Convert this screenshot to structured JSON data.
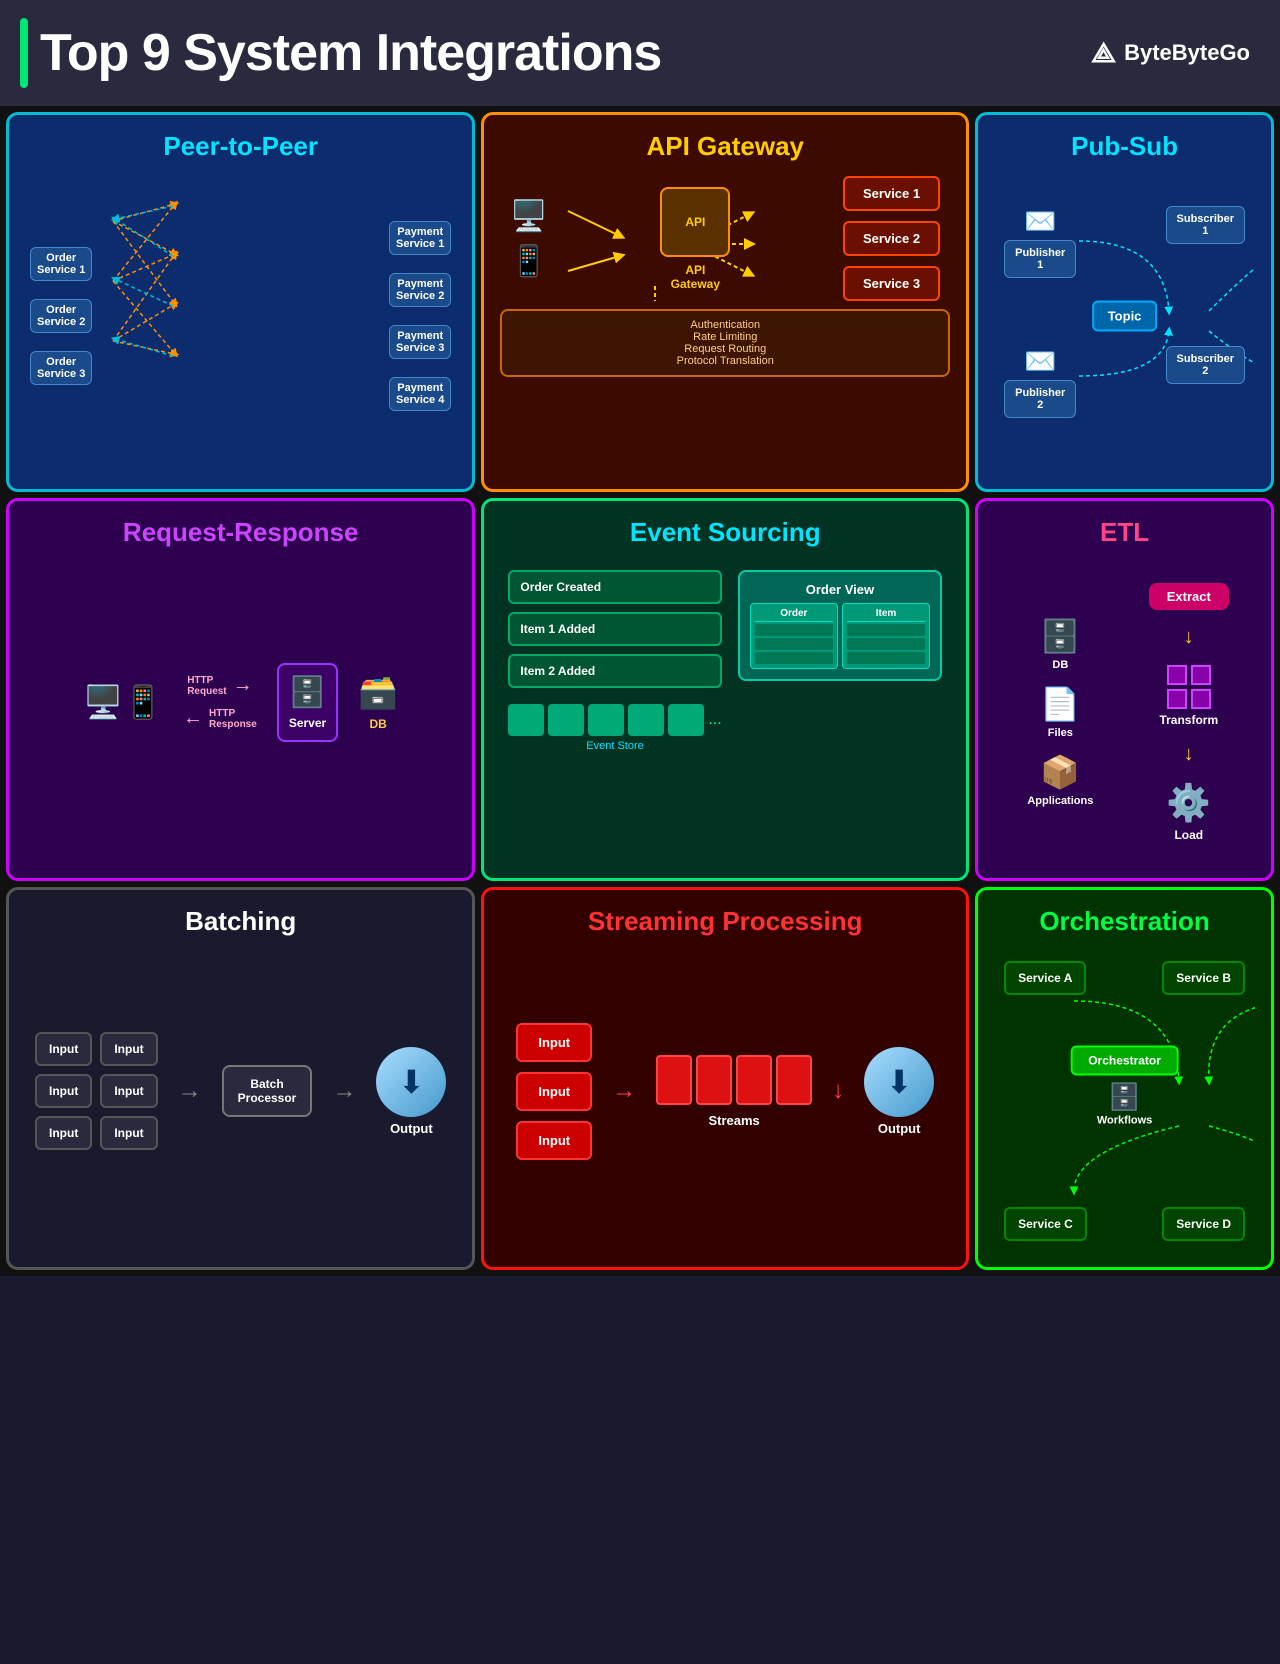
{
  "header": {
    "title": "Top 9 System Integrations",
    "brand": "ByteByteGo"
  },
  "cards": {
    "p2p": {
      "title": "Peer-to-Peer",
      "orders": [
        "Order\nService 1",
        "Order\nService 2",
        "Order\nService 3"
      ],
      "payments": [
        "Payment\nService 1",
        "Payment\nService 2",
        "Payment\nService 3",
        "Payment\nService 4"
      ]
    },
    "api": {
      "title": "API Gateway",
      "services": [
        "Service 1",
        "Service 2",
        "Service 3"
      ],
      "gateway_label": "API\nGateway",
      "bottom_text": "Authentication\nRate Limiting\nRequest Routing\nProtocol\nTranslation"
    },
    "pubsub": {
      "title": "Pub-Sub",
      "publishers": [
        "Publisher\n1",
        "Publisher\n2"
      ],
      "subscribers": [
        "Subscriber\n1",
        "Subscriber\n2"
      ],
      "topic": "Topic"
    },
    "rr": {
      "title": "Request-Response",
      "http_request": "HTTP\nRequest",
      "http_response": "HTTP\nResponse",
      "server_label": "Server",
      "db_label": "DB"
    },
    "es": {
      "title": "Event Sourcing",
      "events": [
        "Order Created",
        "Item 1 Added",
        "Item 2 Added"
      ],
      "store_label": "Event Store",
      "view_title": "Order View",
      "view_col1": "Order",
      "view_col2": "Item"
    },
    "etl": {
      "title": "ETL",
      "extract": "Extract",
      "transform": "Transform",
      "load": "Load",
      "sources": [
        "DB",
        "Files",
        "Applications"
      ]
    },
    "batch": {
      "title": "Batching",
      "inputs": [
        "Input",
        "Input",
        "Input",
        "Input",
        "Input",
        "Input"
      ],
      "processor": "Batch\nProcessor",
      "output": "Output"
    },
    "stream": {
      "title": "Streaming Processing",
      "inputs": [
        "Input",
        "Input",
        "Input"
      ],
      "streams_label": "Streams",
      "output": "Output"
    },
    "orch": {
      "title": "Orchestration",
      "services": [
        "Service A",
        "Service B",
        "Service C",
        "Service D"
      ],
      "orchestrator": "Orchestrator",
      "workflows": "Workflows"
    }
  }
}
